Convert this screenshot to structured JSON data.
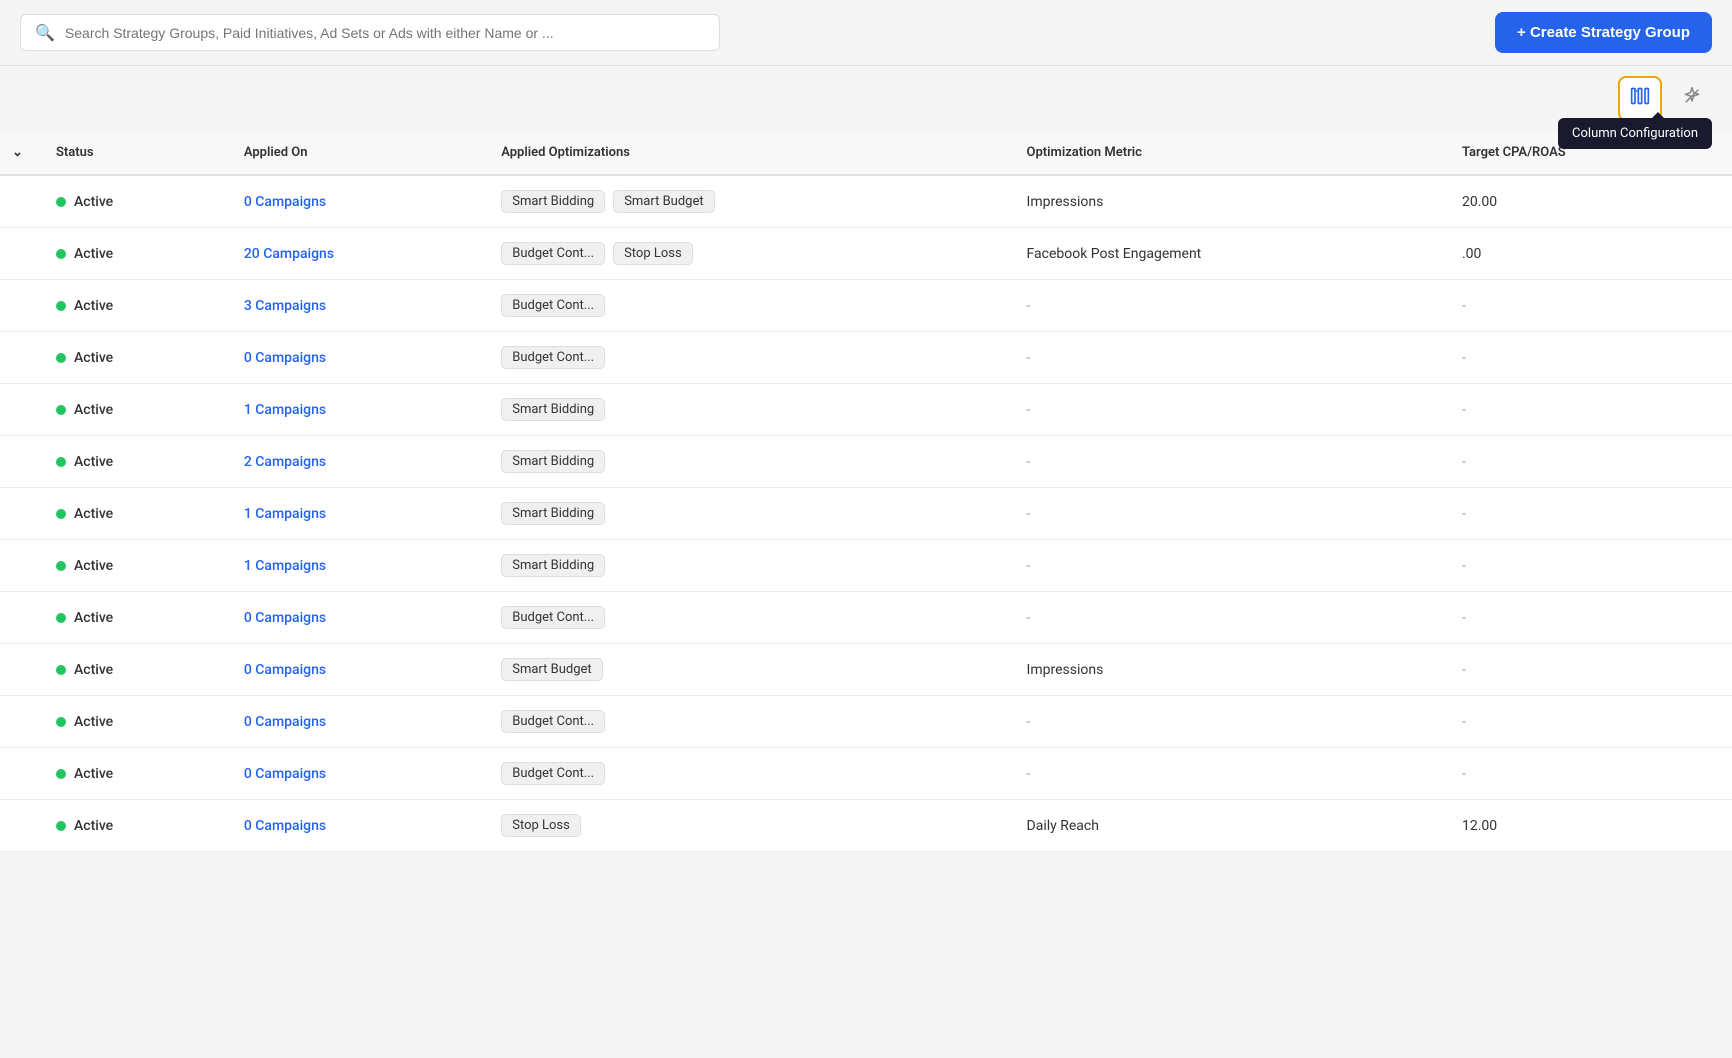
{
  "topbar": {
    "search_placeholder": "Search Strategy Groups, Paid Initiatives, Ad Sets or Ads with either Name or ...",
    "create_button_label": "+ Create Strategy Group"
  },
  "toolbar": {
    "column_config_tooltip": "Column Configuration",
    "column_config_icon": "⊞",
    "wand_icon": "✦"
  },
  "table": {
    "columns": [
      {
        "key": "check",
        "label": ""
      },
      {
        "key": "status",
        "label": "Status"
      },
      {
        "key": "applied_on",
        "label": "Applied On"
      },
      {
        "key": "applied_optimizations",
        "label": "Applied Optimizations"
      },
      {
        "key": "optimization_metric",
        "label": "Optimization Metric"
      },
      {
        "key": "target",
        "label": "Target CPA/ROAS"
      }
    ],
    "rows": [
      {
        "status": "Active",
        "applied_on": "0 Campaigns",
        "optimizations": [
          "Smart Bidding",
          "Smart Budget"
        ],
        "optimization_metric": "Impressions",
        "target": "20.00"
      },
      {
        "status": "Active",
        "applied_on": "20 Campaigns",
        "optimizations": [
          "Budget Cont...",
          "Stop Loss"
        ],
        "optimization_metric": "Facebook Post Engagement",
        "target": ".00"
      },
      {
        "status": "Active",
        "applied_on": "3 Campaigns",
        "optimizations": [
          "Budget Cont..."
        ],
        "optimization_metric": "-",
        "target": "-"
      },
      {
        "status": "Active",
        "applied_on": "0 Campaigns",
        "optimizations": [
          "Budget Cont..."
        ],
        "optimization_metric": "-",
        "target": "-"
      },
      {
        "status": "Active",
        "applied_on": "1 Campaigns",
        "optimizations": [
          "Smart Bidding"
        ],
        "optimization_metric": "-",
        "target": "-"
      },
      {
        "status": "Active",
        "applied_on": "2 Campaigns",
        "optimizations": [
          "Smart Bidding"
        ],
        "optimization_metric": "-",
        "target": "-"
      },
      {
        "status": "Active",
        "applied_on": "1 Campaigns",
        "optimizations": [
          "Smart Bidding"
        ],
        "optimization_metric": "-",
        "target": "-"
      },
      {
        "status": "Active",
        "applied_on": "1 Campaigns",
        "optimizations": [
          "Smart Bidding"
        ],
        "optimization_metric": "-",
        "target": "-"
      },
      {
        "status": "Active",
        "applied_on": "0 Campaigns",
        "optimizations": [
          "Budget Cont..."
        ],
        "optimization_metric": "-",
        "target": "-"
      },
      {
        "status": "Active",
        "applied_on": "0 Campaigns",
        "optimizations": [
          "Smart Budget"
        ],
        "optimization_metric": "Impressions",
        "target": "-"
      },
      {
        "status": "Active",
        "applied_on": "0 Campaigns",
        "optimizations": [
          "Budget Cont..."
        ],
        "optimization_metric": "-",
        "target": "-"
      },
      {
        "status": "Active",
        "applied_on": "0 Campaigns",
        "optimizations": [
          "Budget Cont..."
        ],
        "optimization_metric": "-",
        "target": "-"
      },
      {
        "status": "Active",
        "applied_on": "0 Campaigns",
        "optimizations": [
          "Stop Loss"
        ],
        "optimization_metric": "Daily Reach",
        "target": "12.00"
      }
    ]
  }
}
